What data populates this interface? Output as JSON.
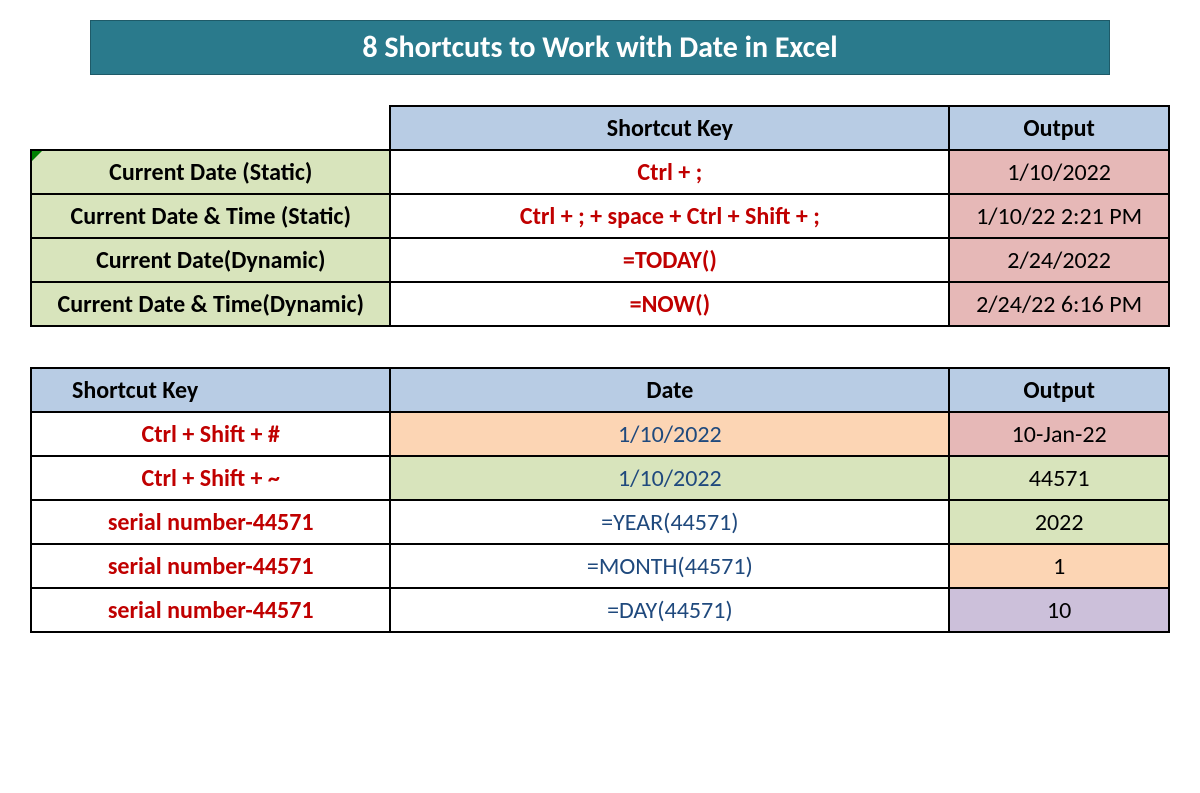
{
  "title": "8 Shortcuts to Work with Date in Excel",
  "table1": {
    "headers": {
      "shortcut": "Shortcut Key",
      "output": "Output"
    },
    "rows": [
      {
        "label": "Current Date (Static)",
        "key": "Ctrl + ;",
        "output": "1/10/2022"
      },
      {
        "label": "Current Date & Time (Static)",
        "key": "Ctrl + ; + space + Ctrl + Shift + ;",
        "output": "1/10/22 2:21 PM"
      },
      {
        "label": "Current Date(Dynamic)",
        "key": "=TODAY()",
        "output": "2/24/2022"
      },
      {
        "label": "Current Date & Time(Dynamic)",
        "key": "=NOW()",
        "output": "2/24/22 6:16 PM"
      }
    ]
  },
  "table2": {
    "headers": {
      "shortcut": "Shortcut Key",
      "date": "Date",
      "output": "Output"
    },
    "rows": [
      {
        "key": "Ctrl + Shift + #",
        "date": "1/10/2022",
        "output": "10-Jan-22"
      },
      {
        "key": "Ctrl + Shift + ~",
        "date": "1/10/2022",
        "output": "44571"
      },
      {
        "key": "serial number-44571",
        "date": "=YEAR(44571)",
        "output": "2022"
      },
      {
        "key": "serial number-44571",
        "date": "=MONTH(44571)",
        "output": "1"
      },
      {
        "key": "serial number-44571",
        "date": "=DAY(44571)",
        "output": "10"
      }
    ]
  }
}
